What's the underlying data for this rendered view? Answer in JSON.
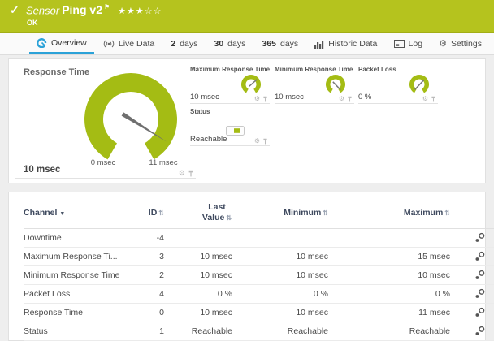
{
  "colors": {
    "brand_green": "#b5c31e",
    "gauge_green": "#a4bc14",
    "tab_active_blue": "#2ba2d8",
    "led_green": "#a4bc14",
    "table_header_text": "#3f4a5f"
  },
  "icons": {
    "check": "✓",
    "flag": "⚑",
    "stars": "★★★☆☆",
    "gear": "⚙",
    "sort": "⇅",
    "sort_desc": "▼"
  },
  "header": {
    "kind": "Sensor",
    "title": "Ping v2",
    "status": "OK",
    "priority_stars_filled": 3,
    "priority_stars_total": 5
  },
  "tabs": [
    {
      "num": "",
      "label": "Overview",
      "active": true
    },
    {
      "num": "",
      "label": "Live Data",
      "active": false
    },
    {
      "num": "2",
      "label": "days",
      "active": false
    },
    {
      "num": "30",
      "label": "days",
      "active": false
    },
    {
      "num": "365",
      "label": "days",
      "active": false
    },
    {
      "num": "",
      "label": "Historic Data",
      "active": false
    },
    {
      "num": "",
      "label": "Log",
      "active": false
    },
    {
      "num": "",
      "label": "Settings",
      "active": false
    }
  ],
  "overview": {
    "response_time": {
      "title": "Response Time",
      "scale_min": "0 msec",
      "scale_max": "11 msec",
      "value": "10 msec",
      "gauge": {
        "min": 0,
        "max": 11,
        "value": 10,
        "unit": "msec"
      }
    },
    "minis": [
      {
        "title": "Maximum Response Time",
        "value": "10 msec",
        "gauge": {
          "value": 10,
          "unit": "msec"
        }
      },
      {
        "title": "Minimum Response Time",
        "value": "10 msec",
        "gauge": {
          "value": 10,
          "unit": "msec"
        }
      },
      {
        "title": "Packet Loss",
        "value": "0 %",
        "gauge": {
          "value": 0,
          "unit": "%"
        }
      }
    ],
    "status": {
      "title": "Status",
      "value": "Reachable"
    }
  },
  "table": {
    "headers": {
      "channel": "Channel",
      "id": "ID",
      "last_value": "Last Value",
      "minimum": "Minimum",
      "maximum": "Maximum"
    },
    "rows": [
      {
        "channel": "Downtime",
        "id": "-4",
        "last": "",
        "min": "",
        "max": ""
      },
      {
        "channel": "Maximum Response Ti...",
        "id": "3",
        "last": "10 msec",
        "min": "10 msec",
        "max": "15 msec"
      },
      {
        "channel": "Minimum Response Time",
        "id": "2",
        "last": "10 msec",
        "min": "10 msec",
        "max": "10 msec"
      },
      {
        "channel": "Packet Loss",
        "id": "4",
        "last": "0 %",
        "min": "0 %",
        "max": "0 %"
      },
      {
        "channel": "Response Time",
        "id": "0",
        "last": "10 msec",
        "min": "10 msec",
        "max": "11 msec"
      },
      {
        "channel": "Status",
        "id": "1",
        "last": "Reachable",
        "min": "Reachable",
        "max": "Reachable"
      }
    ]
  }
}
